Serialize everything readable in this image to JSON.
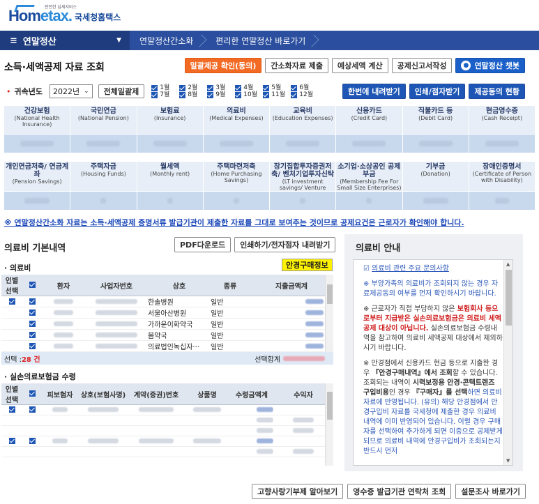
{
  "logo": {
    "small": "안전한 납세서비스",
    "main_a": "Hom",
    "main_b": "etax.",
    "sub": "국세청홈택스"
  },
  "nav": {
    "menu": "연말정산",
    "items": [
      "연말정산간소화",
      "편리한 연말정산 바로가기"
    ]
  },
  "page_title": "소득·세액공제 자료 조회",
  "top_buttons": {
    "consent": "일괄제공 확인(동의)",
    "simple_submit": "간소화자료 제출",
    "estimate": "예상세액 계산",
    "deduct_form": "공제신고서작성",
    "chatbot": "연말정산 챗봇"
  },
  "year_row": {
    "label": "귀속년도",
    "year": "2022년",
    "whole_year": "전체일괄제",
    "months": [
      "1월",
      "2월",
      "3월",
      "4월",
      "5월",
      "6월",
      "7월",
      "8월",
      "9월",
      "10월",
      "11월",
      "12월"
    ]
  },
  "download_buttons": {
    "once": "한번에 내려받기",
    "print": "인쇄/점자받기",
    "status": "제공동의 현황"
  },
  "categories_row1": [
    {
      "ko": "건강보험",
      "en": "(National Health Insurance)"
    },
    {
      "ko": "국민연금",
      "en": "(National Pension)"
    },
    {
      "ko": "보험료",
      "en": "(Insurance)"
    },
    {
      "ko": "의료비",
      "en": "(Medical Expenses)"
    },
    {
      "ko": "교육비",
      "en": "(Education Expenses)"
    },
    {
      "ko": "신용카드",
      "en": "(Credit Card)"
    },
    {
      "ko": "직불카드 등",
      "en": "(Debit Card)"
    },
    {
      "ko": "현금영수증",
      "en": "(Cash Receipt)"
    }
  ],
  "categories_row2": [
    {
      "ko": "개인연금저축/ 연금계좌",
      "en": "(Pension Savings)"
    },
    {
      "ko": "주택자금",
      "en": "(Housing Funds)"
    },
    {
      "ko": "월세액",
      "en": "(Monthly rent)"
    },
    {
      "ko": "주택마련저축",
      "en": "(Home Purchasing Savings)"
    },
    {
      "ko": "장기집합투자증권저축/ 벤처기업투자신탁",
      "en": "(LT investment savings/ Venture investment"
    },
    {
      "ko": "소기업·소상공인 공제부금",
      "en": "(Membership Fee For Small Size Enterprises)"
    },
    {
      "ko": "기부금",
      "en": "(Donation)"
    },
    {
      "ko": "장애인증명서",
      "en": "(Certificate of Person with Disability)"
    }
  ],
  "notice": "※ 연말정산간소화 자료는 소득·세액공제 증명서류 발급기관이 제출한 자료를 그대로 보여주는 것이므로 공제요건은 근로자가 확인해야 합니다.",
  "medical": {
    "title": "의료비 기본내역",
    "pdf_btn": "PDF다운로드",
    "print_btn": "인쇄하기/전자점자 내려받기",
    "section1": "· 의료비",
    "glasses_tag": "안경구매정보",
    "t1_headers": [
      "인별 선택",
      "",
      "환자",
      "사업자번호",
      "상호",
      "종류",
      "지출금액계"
    ],
    "t1_rows": [
      {
        "name": "한솔병원",
        "type": "일반"
      },
      {
        "name": "서울아산병원",
        "type": "일반"
      },
      {
        "name": "가까운이화약국",
        "type": "일반"
      },
      {
        "name": "봄약국",
        "type": "일반"
      },
      {
        "name": "의료법인녹십자···",
        "type": "일반"
      }
    ],
    "selected_label": "선택 : ",
    "selected_count": "28 건",
    "selected_sum_label": "선택합계",
    "section2": "· 실손의료보험금 수령",
    "t2_headers": [
      "인별 선택",
      "",
      "피보험자",
      "상호(보험사명)",
      "계약(증권)번호",
      "상품명",
      "수령금액계",
      "수익자"
    ]
  },
  "guide": {
    "title": "의료비 안내",
    "link": "의료비 관련 주요 문의사항",
    "p1": "※ 부양가족의 의료비가 조회되지 않는 경우 자료제공동의 여부를 먼저 확인하시기 바랍니다.",
    "p2a": "※ 근로자가 직접 부담하지 않은 ",
    "p2b": "보험회사 등으로부터 지급받은 실손의료보험금은 의료비 세액공제 대상이 아닙니다.",
    "p2c": " 실손의료보험금 수령내역을 참고하여 의료비 세액공제 대상에서 제외하시기 바랍니다.",
    "p3a": "※ 안경점에서 신용카드 현금 등으로 지출한 경우 ",
    "p3b": "『안경구매내역』에서 조회",
    "p3c": "할 수 있습니다. 조회되는 내역이 ",
    "p3d": "시력보정용 안경·콘택트렌즈 구입비용",
    "p3e": "인 경우 ",
    "p3f": "『구매자』를 선택",
    "p3g": "하면 의료비자료에 반영됩니다. (유의) 해당 안경점에서 안경구입비 자료를 국세청에 제출한 경우 의료비 내역에 이미 반영되어 있습니다. 이럴 경우 구매자를 선택하여 추가하게 되면 이중으로 공제받게 되므로 의료비 내역에 안경구입비가 조회되는지 반드시 먼저"
  },
  "bottom_buttons": [
    "고향사랑기부제 알아보기",
    "영수증 발급기관 연락처 조회",
    "설문조사 바로가기"
  ]
}
